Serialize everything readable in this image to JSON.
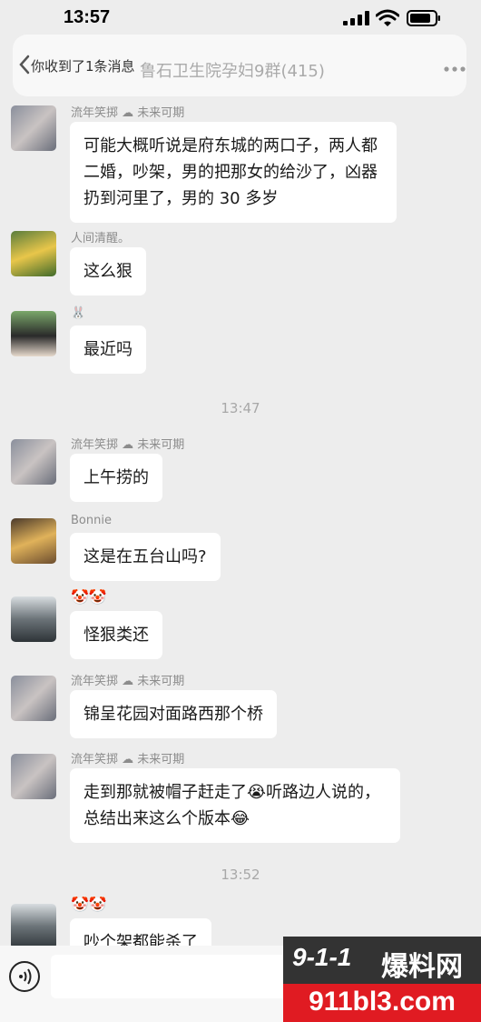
{
  "status_bar": {
    "time": "13:57"
  },
  "header": {
    "notice": "你收到了1条消息",
    "title": "鲁石卫生院孕妇9群(415)"
  },
  "messages": [
    {
      "sender": "流年笑掷 ☁ 未来可期",
      "text": "可能大概听说是府东城的两口子，两人都二婚，吵架，男的把那女的给沙了，凶器扔到河里了，男的 30 多岁"
    },
    {
      "sender": "人间清醒。",
      "text": "这么狠"
    },
    {
      "sender": "🐰",
      "text": "最近吗"
    },
    {
      "sender": "流年笑掷 ☁ 未来可期",
      "text": "上午捞的"
    },
    {
      "sender": "Bonnie",
      "text": "这是在五台山吗?"
    },
    {
      "sender": "🤡🤡",
      "text": "怪狠类还"
    },
    {
      "sender": "流年笑掷 ☁ 未来可期",
      "text": "锦呈花园对面路西那个桥"
    },
    {
      "sender": "流年笑掷 ☁ 未来可期",
      "text": "走到那就被帽子赶走了😭听路边人说的，总结出来这么个版本😂"
    },
    {
      "sender": "🤡🤡",
      "text": "吵个架都能杀了"
    }
  ],
  "time_separators": [
    "13:47",
    "13:52"
  ],
  "watermark": {
    "logo": "9-1-1",
    "name": "爆料网",
    "domain": "911bl3.com"
  },
  "icons": [
    "back-icon",
    "more-icon",
    "voice-icon",
    "emoji-icon",
    "add-icon",
    "signal-icon",
    "wifi-icon",
    "battery-icon"
  ]
}
